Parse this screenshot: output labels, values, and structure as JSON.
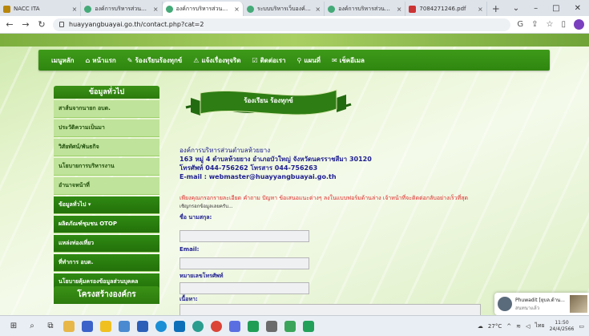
{
  "browser": {
    "tabs": [
      {
        "title": "NACC ITA",
        "active": false
      },
      {
        "title": "องค์การบริหารส่วนตำบล",
        "active": false
      },
      {
        "title": "องค์การบริหารส่วนตำบล",
        "active": true
      },
      {
        "title": "ระบบบริหารเว็บองค์การบ",
        "active": false
      },
      {
        "title": "องค์การบริหารส่วนตำบล",
        "active": false
      },
      {
        "title": "7084271246.pdf",
        "active": false
      }
    ],
    "new_tab": "+",
    "close_glyph": "×",
    "url": "huayyangbuayai.go.th/contact.php?cat=2"
  },
  "menu": [
    {
      "icon": "",
      "label": "เมนูหลัก"
    },
    {
      "icon": "⌂",
      "label": "หน้าแรก"
    },
    {
      "icon": "✎",
      "label": "ร้องเรียนร้องทุกข์"
    },
    {
      "icon": "⚠",
      "label": "แจ้งเรื่องทุจริต"
    },
    {
      "icon": "☑",
      "label": "ติดต่อเรา"
    },
    {
      "icon": "⚲",
      "label": "แผนที่"
    },
    {
      "icon": "✉",
      "label": "เช็คอีเมล"
    }
  ],
  "sidebar": {
    "title": "ข้อมูลทั่วไป",
    "items": [
      {
        "label": "สาส์นจากนายก อบต.",
        "style": "light"
      },
      {
        "label": "ประวัติความเป็นมา",
        "style": "light"
      },
      {
        "label": "วิสัยทัศน์/พันธกิจ",
        "style": "light"
      },
      {
        "label": "นโยบายการบริหารงาน",
        "style": "light"
      },
      {
        "label": "อำนาจหน้าที่",
        "style": "light"
      },
      {
        "label": "ข้อมูลทั่วไป ▾",
        "style": "dark"
      },
      {
        "label": "ผลิตภัณฑ์ชุมชน OTOP",
        "style": "dark"
      },
      {
        "label": "แหล่งท่องเที่ยว",
        "style": "dark"
      },
      {
        "label": "ที่ทำการ อบต.",
        "style": "dark"
      },
      {
        "label": "นโยบายคุ้มครองข้อมูลส่วนบุคคล",
        "style": "dark"
      }
    ],
    "org_title": "โครงสร้างองค์กร"
  },
  "banner": {
    "label": "ร้องเรียน ร้องทุกข์"
  },
  "contact": {
    "lines": [
      "องค์การบริหารส่วนตำบลห้วยยาง",
      "163 หมู่ 4 ตำบลห้วยยาง อำเภอบัวใหญ่ จังหวัดนครราชสีมา 30120",
      "โทรศัพท์ 044-756262 โทรสาร 044-756263",
      "E-mail : webmaster@huayyangbuayai.go.th"
    ],
    "notice": "เพียงคุณกรอกรายละเอียด คำถาม ปัญหา ข้อเสนอแนะต่างๆ ลงในแบบฟอร์มด้านล่าง เจ้าหน้าที่จะติดต่อกลับอย่างเร็วที่สุด",
    "notice_sub": "เชิญกรอกข้อมูลเลยครับ..."
  },
  "form": {
    "name_label": "ชื่อ นามสกุล:",
    "email_label": "Email:",
    "phone_label": "หมายเลขโทรศัพท์",
    "message_label": "เนื้อหา:"
  },
  "chat": {
    "name": "Phuwadit [ยุบล.ด้าน...",
    "status": "สนทนาแล้ว"
  },
  "taskbar": {
    "temperature": "27°C",
    "language": "ไทย",
    "time": "11:50",
    "date": "24/4/2566"
  }
}
